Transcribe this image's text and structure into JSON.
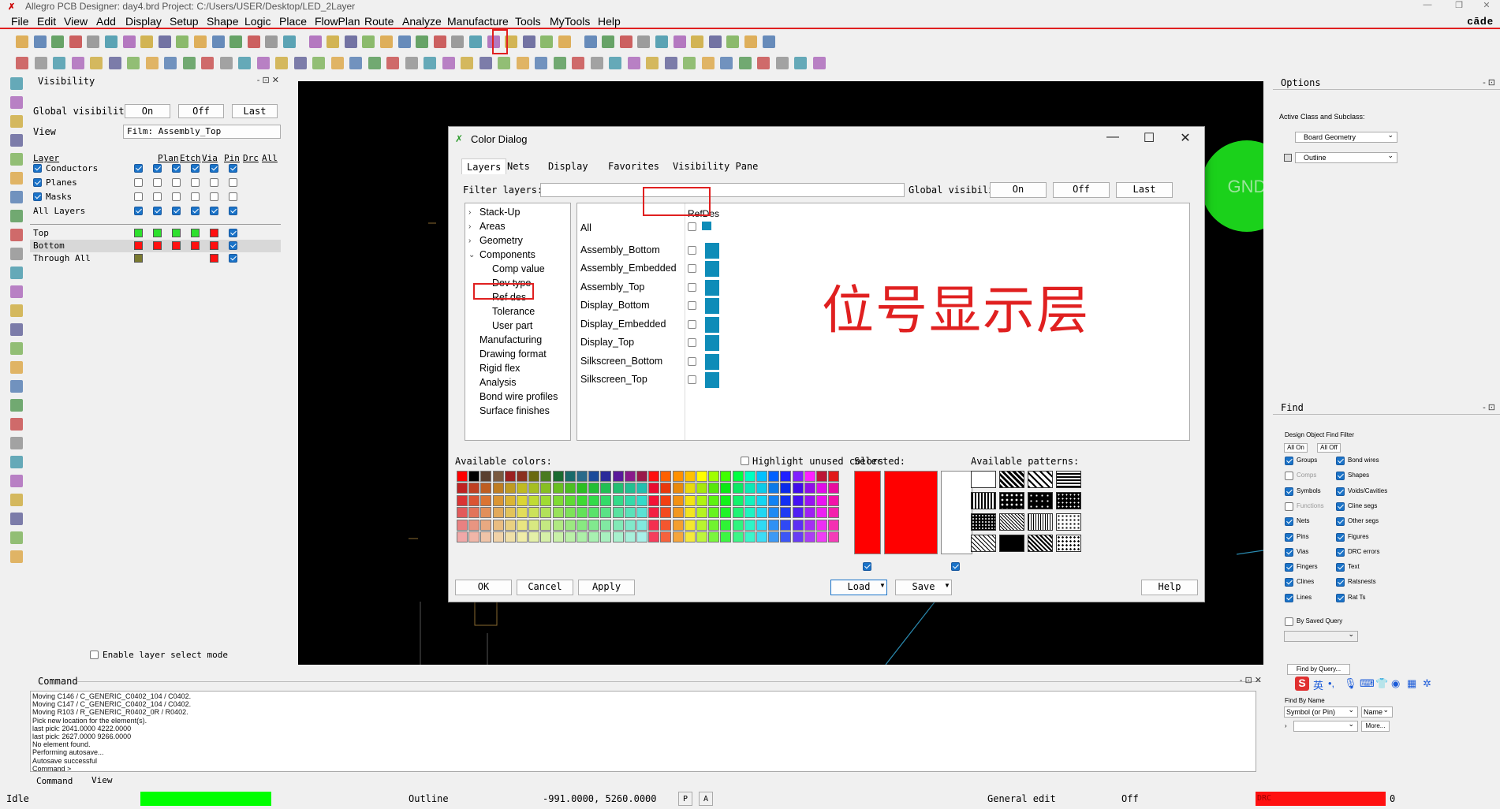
{
  "titlebar": {
    "title": "Allegro PCB Designer: day4.brd  Project: C:/Users/USER/Desktop/LED_2Layer"
  },
  "menubar": {
    "items": [
      "File",
      "Edit",
      "View",
      "Add",
      "Display",
      "Setup",
      "Shape",
      "Logic",
      "Place",
      "FlowPlan",
      "Route",
      "Analyze",
      "Manufacture",
      "Tools",
      "MyTools",
      "Help"
    ],
    "brand": "cāde"
  },
  "visibility": {
    "title": "Visibility",
    "global_label": "Global visibility",
    "on": "On",
    "off": "Off",
    "last": "Last",
    "view_label": "View",
    "view_value": "Film: Assembly_Top",
    "columns": [
      "Layer",
      "Plan",
      "Etch",
      "Via",
      "Pin",
      "Drc",
      "All"
    ],
    "groups": [
      "Conductors",
      "Planes",
      "Masks",
      "All Layers"
    ],
    "layers": [
      "Top",
      "Bottom",
      "Through All"
    ],
    "enable_select": "Enable layer select mode"
  },
  "dialog": {
    "title": "Color Dialog",
    "tabs": [
      "Layers",
      "Nets",
      "Display",
      "Favorites",
      "Visibility Pane"
    ],
    "filter_label": "Filter layers:",
    "global_label": "Global visibility:",
    "on": "On",
    "off": "Off",
    "last": "Last",
    "tree": [
      "Stack-Up",
      "Areas",
      "Geometry",
      "Components",
      "Comp value",
      "Dev type",
      "Ref des",
      "Tolerance",
      "User part",
      "Manufacturing",
      "Drawing format",
      "Rigid flex",
      "Analysis",
      "Bond wire profiles",
      "Surface finishes"
    ],
    "column_header": "RefDes",
    "subclasses": [
      "All",
      "Assembly_Bottom",
      "Assembly_Embedded",
      "Assembly_Top",
      "Display_Bottom",
      "Display_Embedded",
      "Display_Top",
      "Silkscreen_Bottom",
      "Silkscreen_Top"
    ],
    "annotation": "位号显示层",
    "available_colors": "Available colors:",
    "highlight_unused": "Highlight unused colors",
    "selected": "Selected:",
    "available_patterns": "Available patterns:",
    "buttons": {
      "ok": "OK",
      "cancel": "Cancel",
      "apply": "Apply",
      "load": "Load",
      "save": "Save",
      "help": "Help"
    }
  },
  "canvas": {
    "gnd": "GND"
  },
  "options": {
    "title": "Options",
    "subtitle": "Active Class and Subclass:",
    "class_value": "Board Geometry",
    "subclass_value": "Outline"
  },
  "find": {
    "title": "Find",
    "filter_title": "Design Object Find Filter",
    "all_on": "All On",
    "all_off": "All Off",
    "left_items": [
      "Groups",
      "Comps",
      "Symbols",
      "Functions",
      "Nets",
      "Pins",
      "Vias",
      "Fingers",
      "Clines",
      "Lines"
    ],
    "right_items": [
      "Bond wires",
      "Shapes",
      "Voids/Cavities",
      "Cline segs",
      "Other segs",
      "Figures",
      "DRC errors",
      "Text",
      "Ratsnests",
      "Rat Ts"
    ],
    "saved_query": "By Saved Query",
    "find_by_query": "Find by Query...",
    "find_by_name": "Find By Name",
    "name_type": "Symbol (or Pin)",
    "name_mode": "Name",
    "more": "More..."
  },
  "command": {
    "title": "Command",
    "lines": [
      "Moving C146 / C_GENERIC_C0402_104 / C0402.",
      "Moving C147 / C_GENERIC_C0402_104 / C0402.",
      "Moving R103 / R_GENERIC_R0402_0R / R0402.",
      "Pick new location for the element(s).",
      "last pick:  2041.0000 4222.0000",
      "last pick:  2627.0000 9266.0000",
      "No element found.",
      "Performing autosave...",
      "Autosave successful",
      "Command >"
    ],
    "tabs": [
      "Command",
      "View"
    ]
  },
  "status": {
    "mode": "Idle",
    "subclass": "Outline",
    "coords": "-991.0000, 5260.0000",
    "p": "P",
    "a": "A",
    "edit": "General edit",
    "off": "Off",
    "drc": "DRC",
    "count": "0"
  },
  "colors": {
    "accent_red": "#e02020",
    "idle_green": "#00ff00",
    "teal": "#0e8cb8"
  }
}
